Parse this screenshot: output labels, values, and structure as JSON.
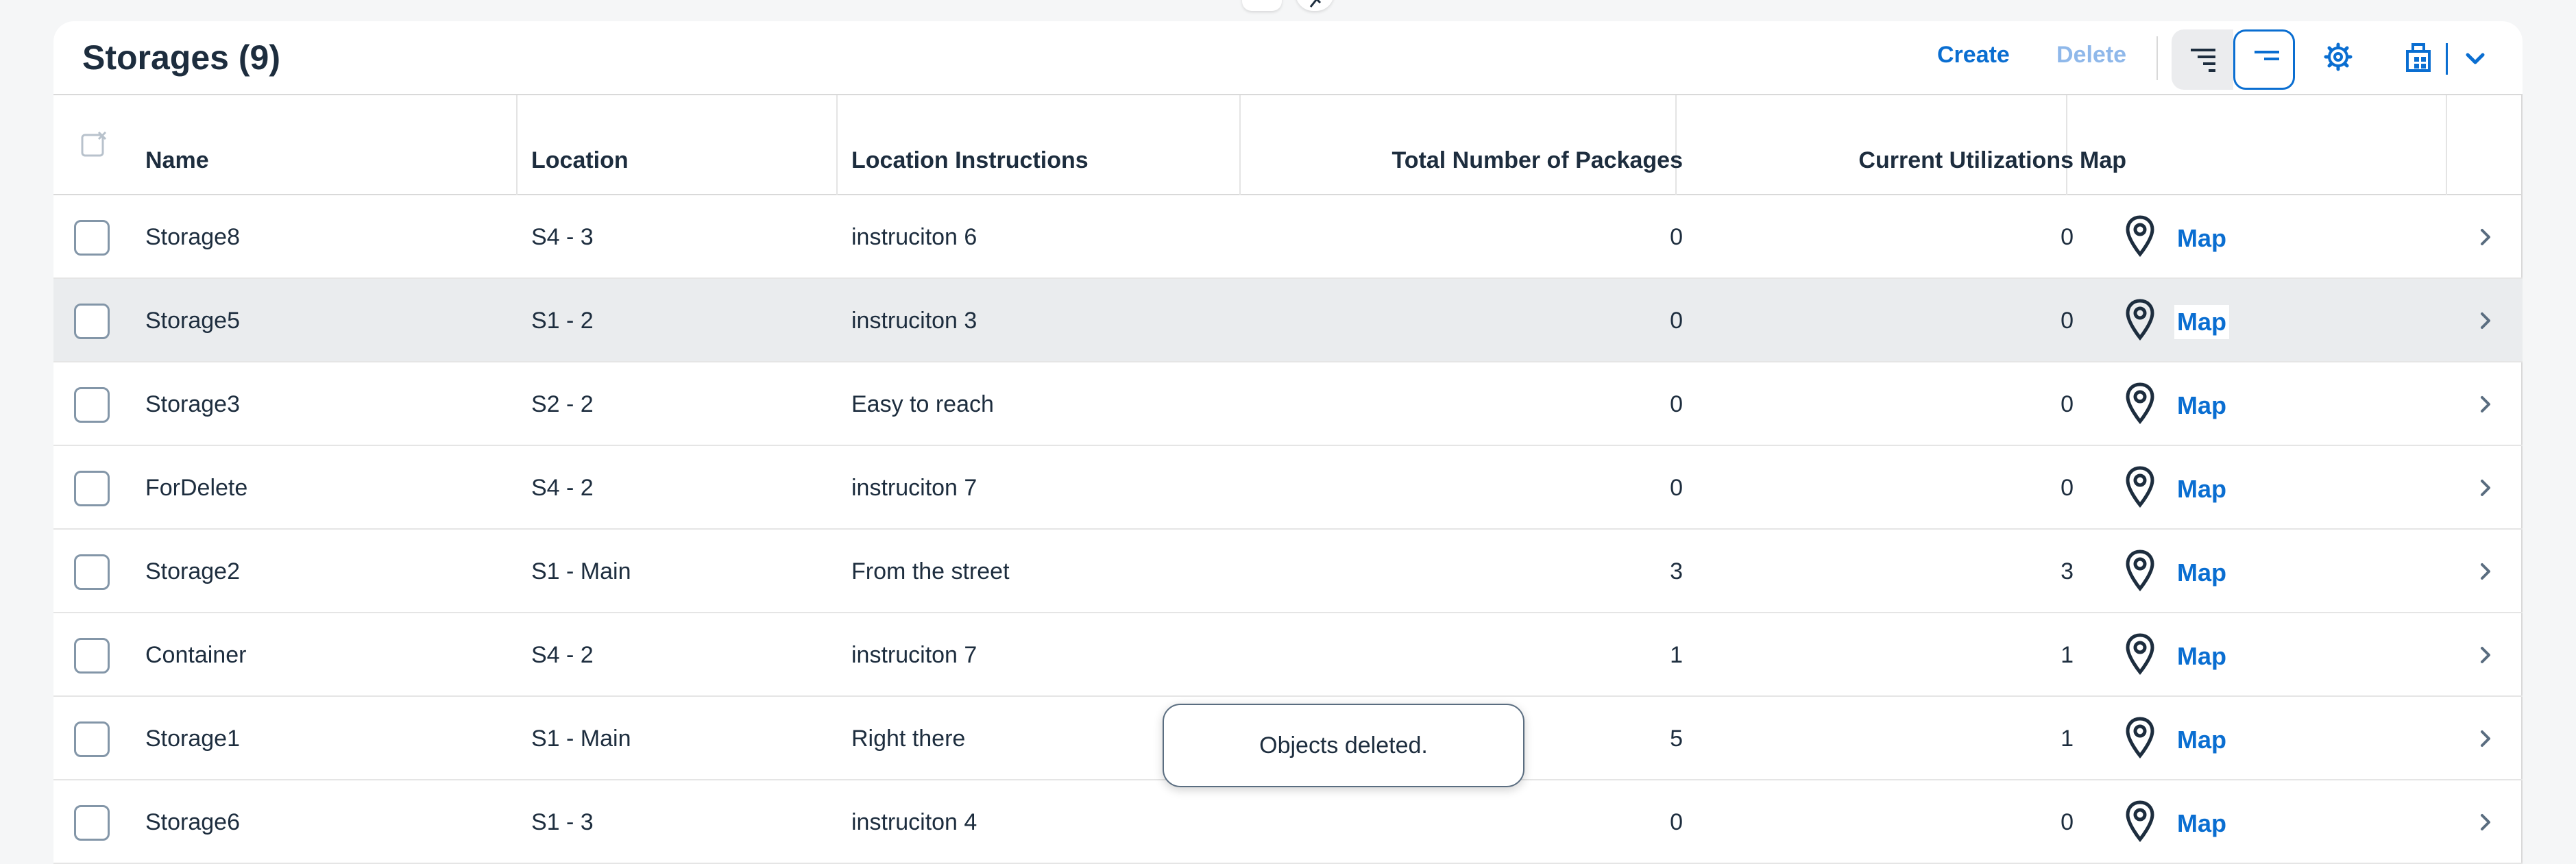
{
  "page": {
    "title": "Storages (9)"
  },
  "toolbar": {
    "create_label": "Create",
    "delete_label": "Delete",
    "icons": [
      "sort-descending-icon",
      "group-icon",
      "gear-icon",
      "export-icon",
      "chevron-down-icon"
    ]
  },
  "table": {
    "columns": [
      "Name",
      "Location",
      "Location Instructions",
      "Total Number of Packages",
      "Current Utilizations",
      "Map"
    ],
    "rows": [
      {
        "name": "Storage8",
        "location": "S4 - 3",
        "instructions": "instruciton 6",
        "packages": "0",
        "utilization": "0",
        "map": "Map"
      },
      {
        "name": "Storage5",
        "location": "S1 - 2",
        "instructions": "instruciton 3",
        "packages": "0",
        "utilization": "0",
        "map": "Map"
      },
      {
        "name": "Storage3",
        "location": "S2 - 2",
        "instructions": "Easy to reach",
        "packages": "0",
        "utilization": "0",
        "map": "Map"
      },
      {
        "name": "ForDelete",
        "location": "S4 - 2",
        "instructions": "instruciton 7",
        "packages": "0",
        "utilization": "0",
        "map": "Map"
      },
      {
        "name": "Storage2",
        "location": "S1 - Main",
        "instructions": "From the street",
        "packages": "3",
        "utilization": "3",
        "map": "Map"
      },
      {
        "name": "Container",
        "location": "S4 - 2",
        "instructions": "instruciton 7",
        "packages": "1",
        "utilization": "1",
        "map": "Map"
      },
      {
        "name": "Storage1",
        "location": "S1 - Main",
        "instructions": "Right there",
        "packages": "5",
        "utilization": "1",
        "map": "Map"
      },
      {
        "name": "Storage6",
        "location": "S1 - 3",
        "instructions": "instruciton 4",
        "packages": "0",
        "utilization": "0",
        "map": "Map"
      }
    ]
  },
  "toast": {
    "message": "Objects deleted."
  },
  "colors": {
    "accent": "#0a6ed1",
    "disabled_accent": "#8fb8ea",
    "text": "#1d2d3e",
    "row_highlight": "#eaecee",
    "background": "#f5f6f7"
  }
}
